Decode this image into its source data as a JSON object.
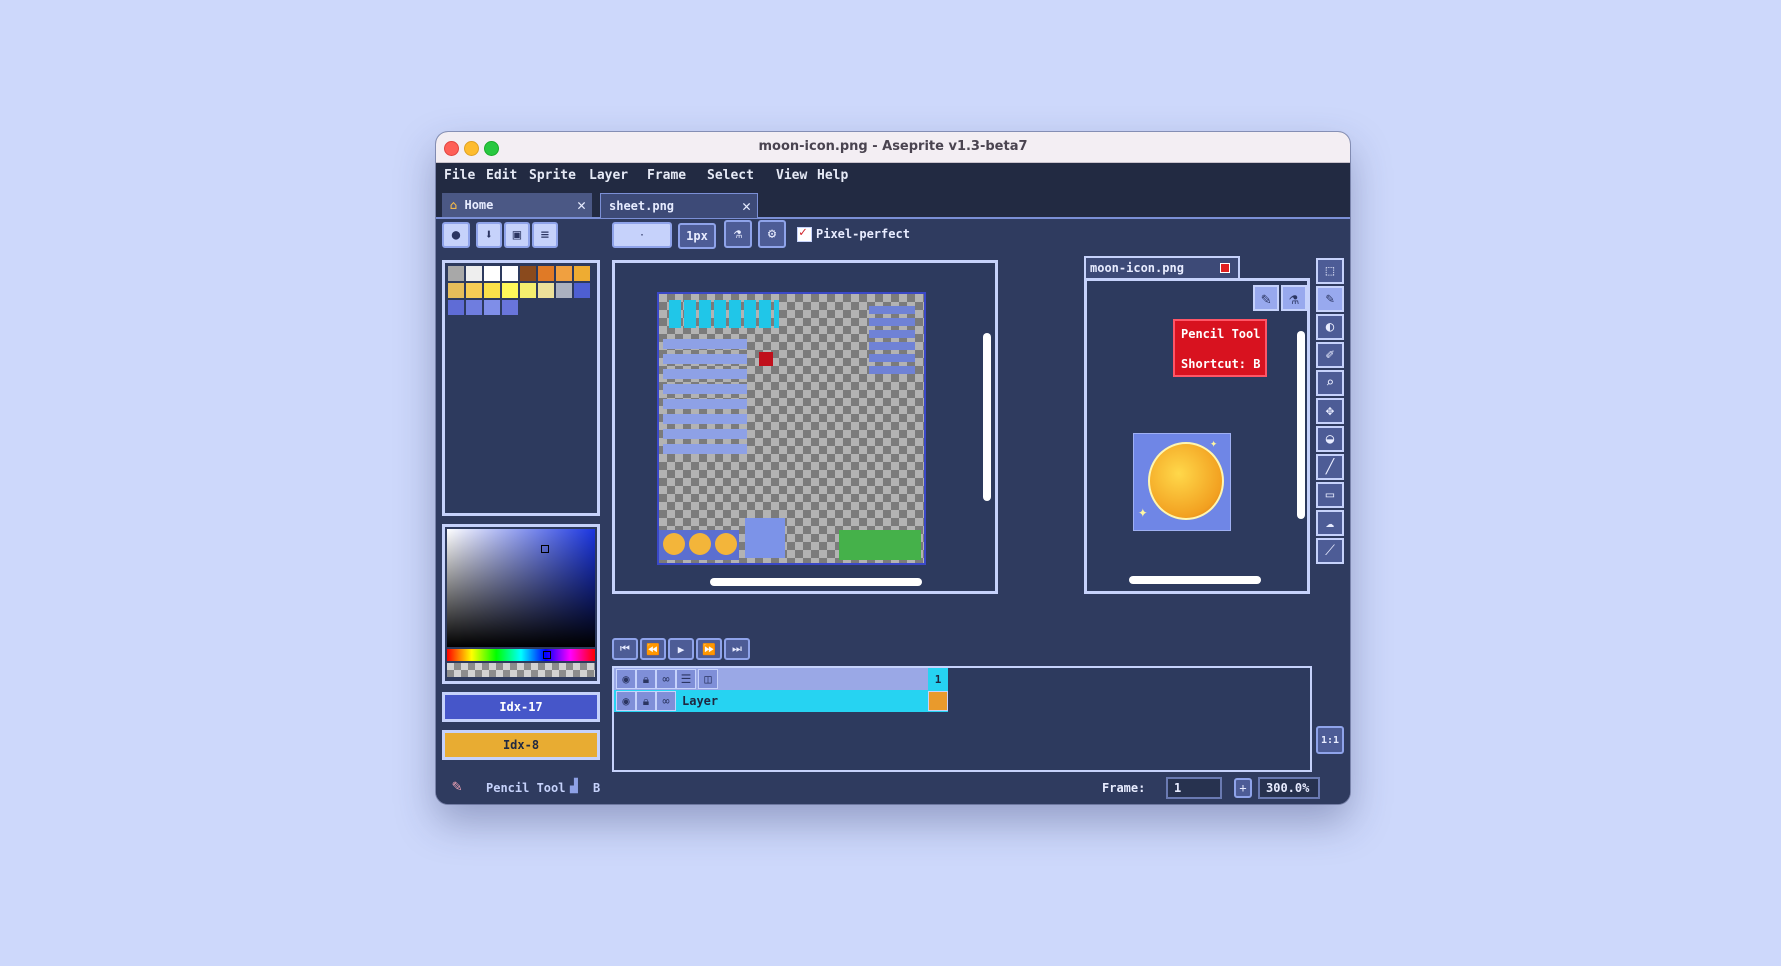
{
  "window": {
    "title": "moon-icon.png - Aseprite v1.3-beta7"
  },
  "menu": [
    "File",
    "Edit",
    "Sprite",
    "Layer",
    "Frame",
    "Select",
    "View",
    "Help"
  ],
  "tabs": [
    {
      "label": "Home",
      "icon": "home-icon",
      "close": "✕"
    },
    {
      "label": "sheet.png",
      "close": "✕"
    }
  ],
  "toolbar": {
    "brush_size": "1px",
    "pixel_perfect_label": "Pixel-perfect",
    "pixel_perfect_checked": true
  },
  "palette_colors": [
    "#a8a8a8",
    "#eeeeee",
    "#ffffff",
    "#ffffff",
    "#8a4a1d",
    "#e07a26",
    "#f0a040",
    "#eeac32",
    "#e6bd5a",
    "#f6cc55",
    "#fbe14a",
    "#fff85a",
    "#f4ee6e",
    "#ece09a",
    "#aab0c0",
    "#4e5fd2",
    "#5f6cd6",
    "#6f7ddf",
    "#7f8ee8",
    "#6975db"
  ],
  "color_picker": {
    "hue_indicator_label": ""
  },
  "fg_color": {
    "label": "Idx-17",
    "color": "#4656c9"
  },
  "bg_color": {
    "label": "Idx-8",
    "color": "#e8ac32"
  },
  "preview": {
    "title": "moon-icon.png",
    "tooltip_line1": "Pencil Tool",
    "tooltip_line2": "Shortcut: B"
  },
  "timeline": {
    "frame_header": "1",
    "layer_name": "Layer"
  },
  "status": {
    "tool_name": "Pencil Tool",
    "shortcut": "B",
    "frame_label": "Frame:",
    "frame_value": "1",
    "zoom": "300.0%"
  },
  "ratio_button": "1:1"
}
